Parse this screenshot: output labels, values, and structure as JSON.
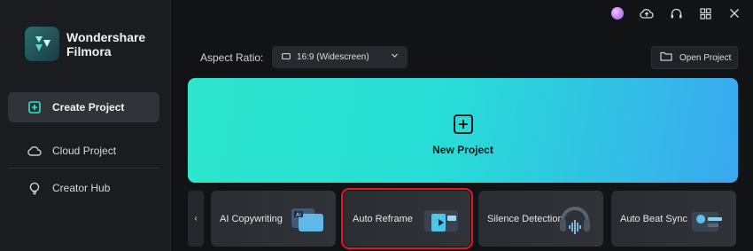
{
  "app": {
    "brand_line1": "Wondershare",
    "brand_line2": "Filmora"
  },
  "sidebar": {
    "items": [
      {
        "label": "Create Project",
        "icon": "add-square-icon",
        "active": true
      },
      {
        "label": "Cloud Project",
        "icon": "cloud-icon",
        "active": false
      },
      {
        "label": "Creator Hub",
        "icon": "lightbulb-icon",
        "active": false
      }
    ]
  },
  "topbar": {
    "icons": [
      "avatar",
      "cloud-upload-icon",
      "headset-icon",
      "grid-icon",
      "close-icon"
    ]
  },
  "aspect": {
    "label": "Aspect Ratio:",
    "value": "16:9 (Widescreen)"
  },
  "open_project": {
    "label": "Open Project"
  },
  "new_project": {
    "label": "New Project"
  },
  "features": [
    {
      "label": "AI Copywriting"
    },
    {
      "label": "Auto Reframe",
      "highlighted": true
    },
    {
      "label": "Silence Detection"
    },
    {
      "label": "Auto Beat Sync"
    }
  ],
  "prev_button": {
    "label": "‹"
  },
  "colors": {
    "accent_start": "#2de6cc",
    "accent_end": "#3aa8f0",
    "highlight_border": "#e0192a"
  }
}
